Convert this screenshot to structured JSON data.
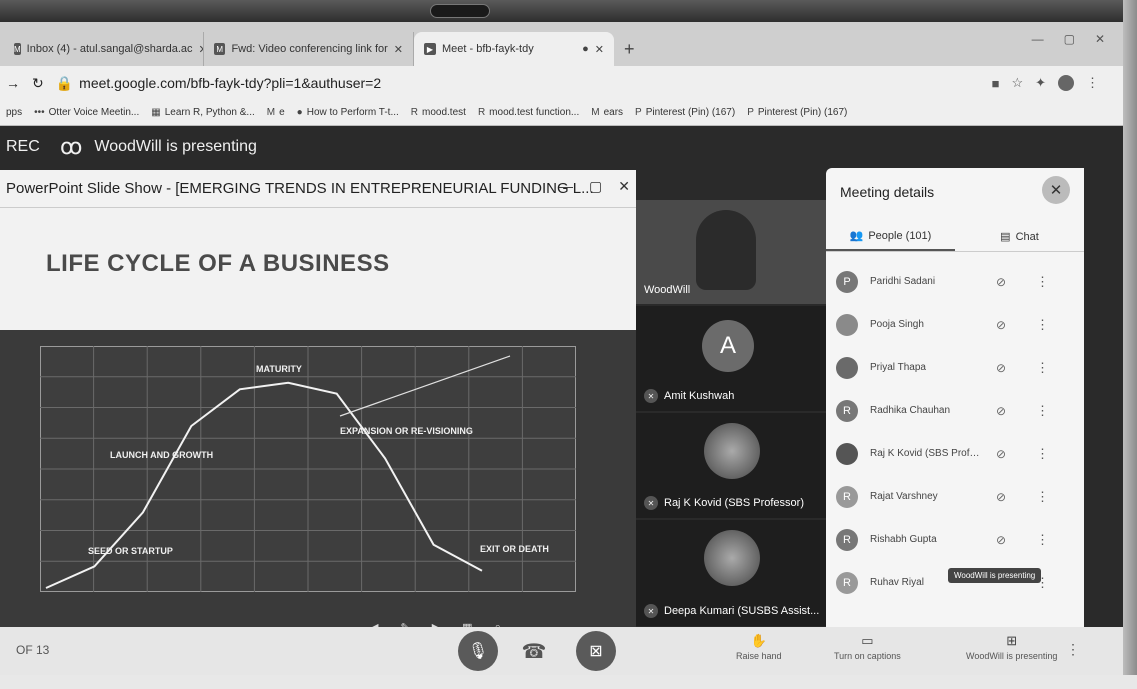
{
  "browser": {
    "tabs": [
      {
        "label": "Inbox (4) - atul.sangal@sharda.ac",
        "favicon": "M"
      },
      {
        "label": "Fwd: Video conferencing link for",
        "favicon": "M"
      },
      {
        "label": "Meet - bfb-fayk-tdy",
        "favicon": "▶"
      }
    ],
    "new_tab": "+",
    "url": "meet.google.com/bfb-fayk-tdy?pli=1&authuser=2",
    "bookmarks": [
      {
        "label": "pps",
        "icon": ""
      },
      {
        "label": "Otter Voice Meetin...",
        "icon": "•••"
      },
      {
        "label": "Learn R, Python &...",
        "icon": "▦"
      },
      {
        "label": "e",
        "icon": "M"
      },
      {
        "label": "How to Perform T-t...",
        "icon": "●"
      },
      {
        "label": "mood.test",
        "icon": "R"
      },
      {
        "label": "mood.test function...",
        "icon": "R"
      },
      {
        "label": "ears",
        "icon": "M"
      },
      {
        "label": "Pinterest (Pin) (167)",
        "icon": "P"
      },
      {
        "label": "Pinterest (Pin) (167)",
        "icon": "P"
      }
    ]
  },
  "meet": {
    "rec_label": "REC",
    "presenting_text": "WoodWill is presenting",
    "ppt_window_title": "PowerPoint Slide Show - [EMERGING TRENDS IN ENTREPRENEURIAL FUNDING L...",
    "slide_heading": "LIFE CYCLE OF A BUSINESS",
    "slide_count": "OF 13",
    "tiles": [
      {
        "name": "WoodWill"
      },
      {
        "name": "Amit Kushwah",
        "initial": "A"
      },
      {
        "name": "Raj K Kovid (SBS Professor)"
      },
      {
        "name": "Deepa Kumari (SUSBS Assist..."
      }
    ],
    "panel": {
      "title": "Meeting details",
      "people_tab": "People (101)",
      "chat_tab": "Chat",
      "people": [
        {
          "name": "Paridhi Sadani",
          "initial": "P"
        },
        {
          "name": "Pooja Singh",
          "initial": ""
        },
        {
          "name": "Priyal Thapa",
          "initial": ""
        },
        {
          "name": "Radhika Chauhan",
          "initial": "R"
        },
        {
          "name": "Raj K Kovid (SBS Profes...",
          "initial": ""
        },
        {
          "name": "Rajat Varshney",
          "initial": "R"
        },
        {
          "name": "Rishabh Gupta",
          "initial": "R"
        },
        {
          "name": "Ruhav Riyal",
          "initial": "R"
        }
      ],
      "tooltip": "WoodWill is presenting"
    },
    "controls": {
      "raise_hand": "Raise hand",
      "captions": "Turn on captions",
      "present": "WoodWill is presenting"
    }
  },
  "chart_data": {
    "type": "line",
    "title": "LIFE CYCLE OF A BUSINESS",
    "annotations": [
      "MATURITY",
      "LAUNCH AND GROWTH",
      "EXPANSION OR RE-VISIONING",
      "SEED OR STARTUP",
      "EXIT OR DEATH"
    ],
    "series": [
      {
        "values": [
          0,
          10,
          35,
          75,
          92,
          95,
          90,
          60,
          20,
          8
        ]
      }
    ]
  }
}
